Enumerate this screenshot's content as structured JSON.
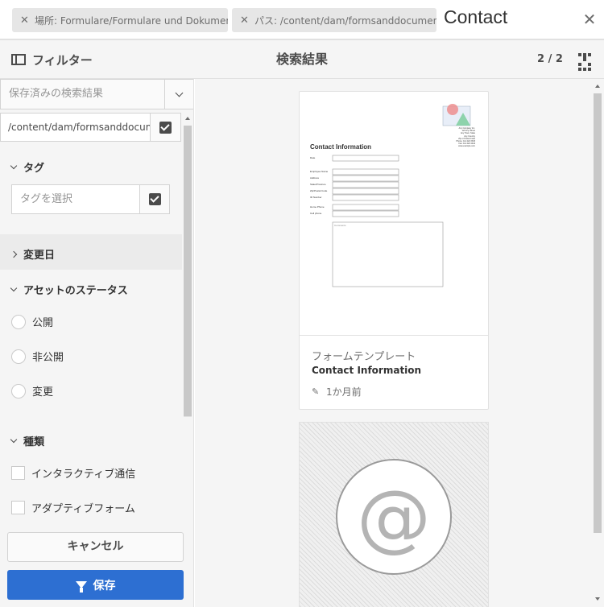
{
  "search": {
    "chips": [
      {
        "label": "場所: Formulare/Formulare und Dokumente"
      },
      {
        "label": "パス: /content/dam/formsanddocuments"
      }
    ],
    "query": "Contact"
  },
  "header": {
    "filter_label": "フィルター",
    "results_title": "検索結果",
    "count": "2 / 2"
  },
  "filters": {
    "saved_search_placeholder": "保存済みの検索結果",
    "path_value": "/content/dam/formsanddocume",
    "tags": {
      "title": "タグ",
      "placeholder": "タグを選択"
    },
    "modified": {
      "title": "変更日"
    },
    "status": {
      "title": "アセットのステータス",
      "options": [
        "公開",
        "非公開",
        "変更"
      ]
    },
    "type": {
      "title": "種類",
      "options": [
        "インタラクティブ通信",
        "アダプティブフォーム"
      ]
    },
    "cancel_label": "キャンセル",
    "save_label": "保存"
  },
  "results": [
    {
      "type": "フォームテンプレート",
      "title": "Contact Information",
      "modified": "1か月前",
      "thumbnail": {
        "heading": "Contact Information",
        "fields": [
          "Date",
          "Employee Name",
          "Address",
          "State/Province",
          "Zip/Postal Code",
          "ID Number",
          "Home Phone",
          "Cell phone"
        ],
        "comments_label": "Comments",
        "company_lines": [
          "Any Company Inc.",
          "123 Any Street",
          "Any Town, State",
          "Any Country",
          "Zip or Postal Code",
          "Phone: 111 222 3333",
          "Fax: 111 222 4444",
          "www.example.com"
        ]
      }
    },
    {
      "type": "",
      "title": "",
      "modified": "",
      "thumbnail_symbol": "@"
    }
  ],
  "colors": {
    "accent": "#2d6fd2",
    "panel_bg": "#f5f5f5",
    "chip_bg": "#e6e6e6"
  }
}
